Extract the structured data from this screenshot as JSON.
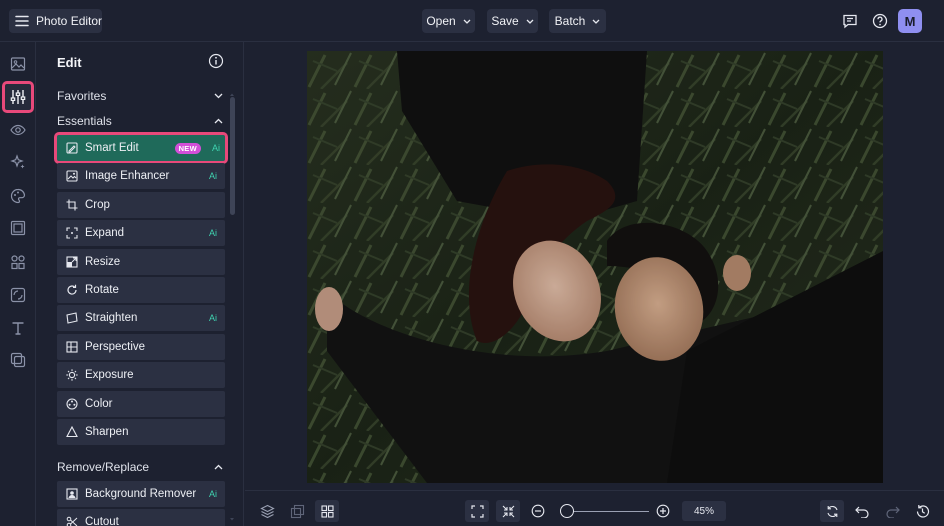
{
  "app": {
    "title": "Photo Editor",
    "avatar_initial": "M"
  },
  "toolbar": {
    "menus": [
      {
        "label": "Open"
      },
      {
        "label": "Save"
      },
      {
        "label": "Batch"
      }
    ]
  },
  "panel": {
    "title": "Edit",
    "sections": {
      "favorites": "Favorites",
      "essentials": "Essentials",
      "remove_replace": "Remove/Replace"
    },
    "tools": [
      {
        "label": "Smart Edit",
        "badge": "NEW",
        "ai": "Ai",
        "icon": "smart-edit-icon"
      },
      {
        "label": "Image Enhancer",
        "ai": "Ai",
        "icon": "image-enhancer-icon"
      },
      {
        "label": "Crop",
        "icon": "crop-icon"
      },
      {
        "label": "Expand",
        "ai": "Ai",
        "icon": "expand-icon"
      },
      {
        "label": "Resize",
        "icon": "resize-icon"
      },
      {
        "label": "Rotate",
        "icon": "rotate-icon"
      },
      {
        "label": "Straighten",
        "ai": "Ai",
        "icon": "straighten-icon"
      },
      {
        "label": "Perspective",
        "icon": "perspective-icon"
      },
      {
        "label": "Exposure",
        "icon": "exposure-icon"
      },
      {
        "label": "Color",
        "icon": "color-icon"
      },
      {
        "label": "Sharpen",
        "icon": "sharpen-icon"
      }
    ],
    "remove_tools": [
      {
        "label": "Background Remover",
        "ai": "Ai",
        "icon": "background-remover-icon"
      },
      {
        "label": "Cutout",
        "icon": "cutout-icon"
      }
    ]
  },
  "zoom": {
    "value": "45%",
    "level": 0.05
  },
  "colors": {
    "background": "#1d2130",
    "button": "#2b3042",
    "accent_teal": "#1f6a5a",
    "highlight_pink": "#e8497a",
    "ai_green": "#3fd3b0",
    "new_badge": "#d24fd8",
    "avatar": "#8f8ff0"
  }
}
